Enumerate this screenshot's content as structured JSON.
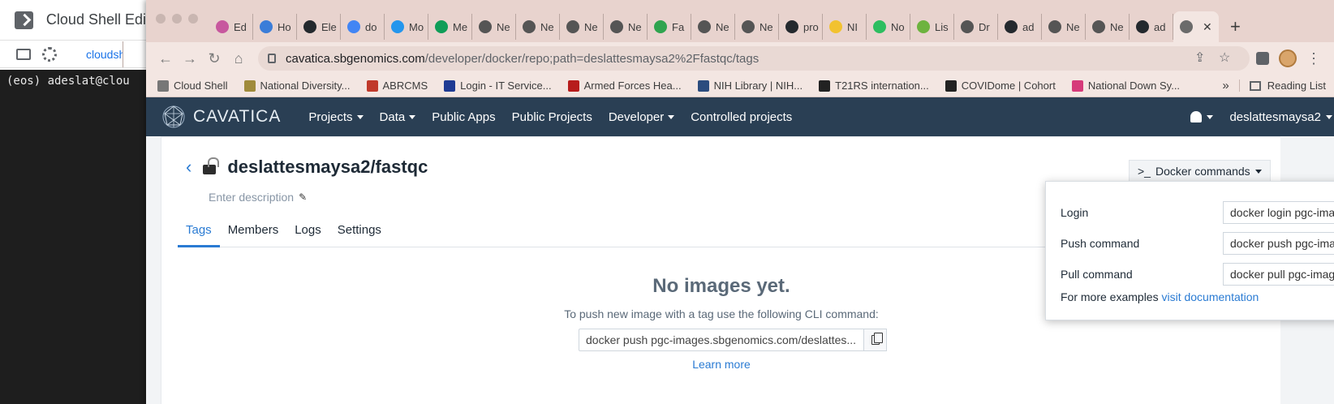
{
  "bg_window": {
    "title": "Cloud Shell Edi",
    "tab_label": "cloudshell",
    "terminal_line": "(eos) adeslat@clou"
  },
  "browser": {
    "tabs": [
      {
        "label": "Ed",
        "icon": "cog-pink-icon",
        "color": "#c7589e"
      },
      {
        "label": "Ho",
        "icon": "globe-icon",
        "color": "#3b7dd8"
      },
      {
        "label": "Ele",
        "icon": "github-icon",
        "color": "#24292e"
      },
      {
        "label": "do",
        "icon": "google-icon",
        "color": "#4285f4"
      },
      {
        "label": "Mo",
        "icon": "docker-icon",
        "color": "#2496ed"
      },
      {
        "label": "Me",
        "icon": "sheets-icon",
        "color": "#0f9d58"
      },
      {
        "label": "Ne",
        "icon": "chrome-icon",
        "color": "#555555"
      },
      {
        "label": "Ne",
        "icon": "chrome-icon",
        "color": "#555555"
      },
      {
        "label": "Ne",
        "icon": "chrome-icon",
        "color": "#555555"
      },
      {
        "label": "Ne",
        "icon": "chrome-icon",
        "color": "#555555"
      },
      {
        "label": "Fa",
        "icon": "loading-icon",
        "color": "#2fa44f"
      },
      {
        "label": "Ne",
        "icon": "chrome-icon",
        "color": "#555555"
      },
      {
        "label": "Ne",
        "icon": "chrome-icon",
        "color": "#555555"
      },
      {
        "label": "pro",
        "icon": "github-icon",
        "color": "#24292e"
      },
      {
        "label": "NI",
        "icon": "nih-icon",
        "color": "#f2c230"
      },
      {
        "label": "No",
        "icon": "evernote-icon",
        "color": "#2dbe60"
      },
      {
        "label": "Lis",
        "icon": "lis-icon",
        "color": "#6db33f"
      },
      {
        "label": "Dr",
        "icon": "drive-icon",
        "color": "#555555"
      },
      {
        "label": "ad",
        "icon": "github-icon",
        "color": "#24292e"
      },
      {
        "label": "Ne",
        "icon": "chrome-icon",
        "color": "#555555"
      },
      {
        "label": "Ne",
        "icon": "chrome-icon",
        "color": "#555555"
      },
      {
        "label": "ad",
        "icon": "github-icon",
        "color": "#24292e"
      }
    ],
    "active_tab_close": "✕",
    "new_tab": "+",
    "url_host": "cavatica.sbgenomics.com",
    "url_path": "/developer/docker/repo;path=deslattesmaysa2%2Ffastqc/tags",
    "bookmarks": [
      {
        "label": "Cloud Shell",
        "color": "#777777"
      },
      {
        "label": "National Diversity...",
        "color": "#a08b3b"
      },
      {
        "label": "ABRCMS",
        "color": "#c0392b"
      },
      {
        "label": "Login - IT Service...",
        "color": "#1f3a93"
      },
      {
        "label": "Armed Forces Hea...",
        "color": "#b71c1c"
      },
      {
        "label": "NIH Library | NIH...",
        "color": "#2b4c7e"
      },
      {
        "label": "T21RS internation...",
        "color": "#222222"
      },
      {
        "label": "COVIDome | Cohort",
        "color": "#222222"
      },
      {
        "label": "National Down Sy...",
        "color": "#d63a7a"
      }
    ],
    "bookmarks_more": "»",
    "reading_list": "Reading List"
  },
  "appnav": {
    "brand": "CAVATICA",
    "items": [
      {
        "label": "Projects",
        "dropdown": true
      },
      {
        "label": "Data",
        "dropdown": true
      },
      {
        "label": "Public Apps",
        "dropdown": false
      },
      {
        "label": "Public Projects",
        "dropdown": false
      },
      {
        "label": "Developer",
        "dropdown": true
      },
      {
        "label": "Controlled projects",
        "dropdown": false
      }
    ],
    "user": "deslattesmaysa2"
  },
  "repo": {
    "title": "deslattesmaysa2/fastqc",
    "description_placeholder": "Enter description",
    "tabs": [
      "Tags",
      "Members",
      "Logs",
      "Settings"
    ],
    "active_tab": "Tags",
    "empty_title": "No images yet.",
    "empty_sub": "To push new image with a tag use the following CLI command:",
    "push_cmd": "docker push pgc-images.sbgenomics.com/deslattes...",
    "learn_more": "Learn more",
    "docker_button": "Docker commands"
  },
  "docker_panel": {
    "rows": [
      {
        "label": "Login",
        "value": "docker login pgc-images.sb..."
      },
      {
        "label": "Push command",
        "value": "docker push pgc-images.sb..."
      },
      {
        "label": "Pull command",
        "value": "docker pull pgc-images.sbg..."
      }
    ],
    "more_text": "For more examples",
    "more_link": "visit documentation"
  }
}
